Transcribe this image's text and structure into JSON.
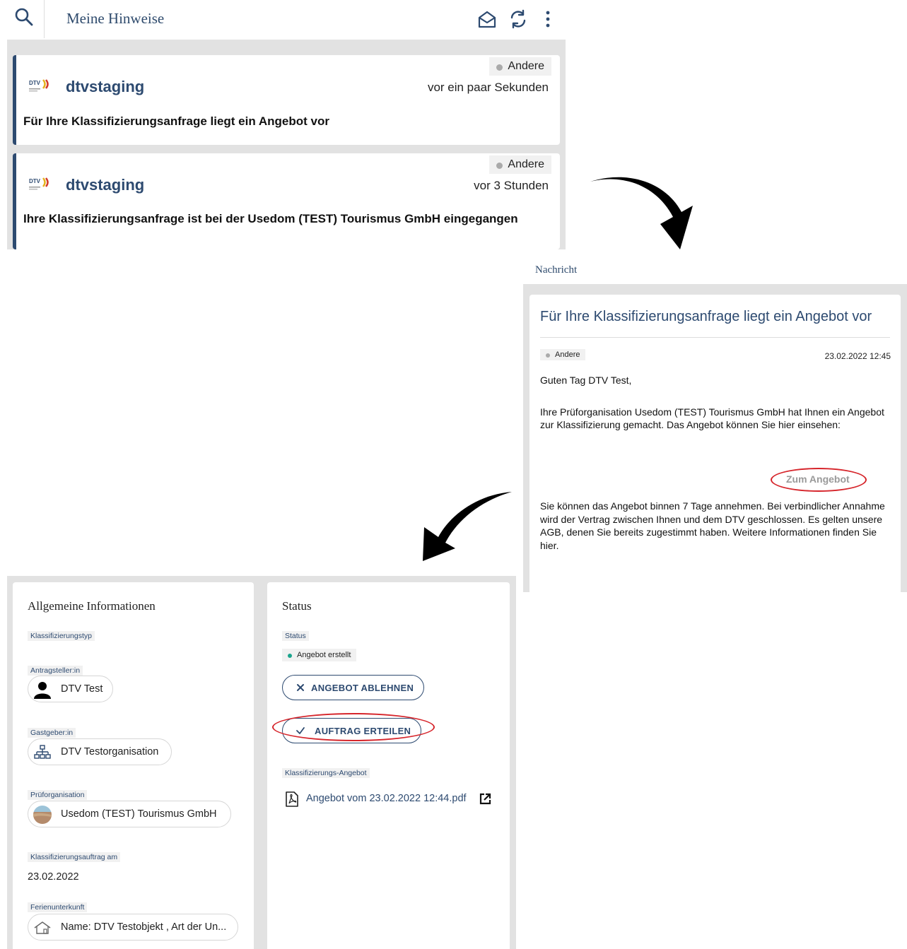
{
  "list_panel": {
    "title": "Meine Hinweise",
    "icons": [
      "search-icon",
      "envelope-open-icon",
      "refresh-icon",
      "more-vertical-icon"
    ],
    "notifications": [
      {
        "tag": "Andere",
        "sender": "dtvstaging",
        "time": "vor ein paar Sekunden",
        "text": "Für Ihre Klassifizierungsanfrage liegt ein Angebot vor"
      },
      {
        "tag": "Andere",
        "sender": "dtvstaging",
        "time": "vor 3 Stunden",
        "text": "Ihre Klassifizierungsanfrage ist bei der Usedom (TEST) Tourismus GmbH eingegangen"
      }
    ]
  },
  "message_panel": {
    "label": "Nachricht",
    "title": "Für Ihre Klassifizierungsanfrage liegt ein Angebot vor",
    "tag": "Andere",
    "date": "23.02.2022 12:45",
    "greeting": "Guten Tag DTV Test,",
    "paragraph1": "Ihre Prüforganisation Usedom (TEST) Tourismus GmbH hat Ihnen ein Angebot zur Klassifizierung gemacht. Das Angebot können Sie hier einsehen:",
    "cta_label": "Zum Angebot",
    "paragraph2": "Sie können das Angebot binnen 7 Tage annehmen. Bei verbindlicher Annahme wird der Vertrag zwischen Ihnen und dem DTV geschlossen. Es gelten unsere AGB, denen Sie bereits zugestimmt haben. Weitere Informationen finden Sie hier."
  },
  "detail_panel": {
    "info_card": {
      "title": "Allgemeine Informationen",
      "fields": {
        "type_label": "Klassifizierungstyp",
        "applicant_label": "Antragsteller:in",
        "applicant_value": "DTV Test",
        "host_label": "Gastgeber:in",
        "host_value": "DTV Testorganisation",
        "inspector_label": "Prüforganisation",
        "inspector_value": "Usedom (TEST) Tourismus GmbH",
        "order_date_label": "Klassifizierungsauftrag am",
        "order_date_value": "23.02.2022",
        "property_label": "Ferienunterkunft",
        "property_value": "Name: DTV Testobjekt , Art der Un..."
      }
    },
    "status_card": {
      "title": "Status",
      "status_label": "Status",
      "status_value": "Angebot erstellt",
      "status_color": "#1aa58d",
      "decline_button": "ANGEBOT ABLEHNEN",
      "accept_button": "AUFTRAG ERTEILEN",
      "offer_label": "Klassifizierungs-Angebot",
      "offer_file": "Angebot vom 23.02.2022 12:44.pdf"
    }
  },
  "colors": {
    "brand_blue": "#2d4a70",
    "highlight_red": "#d6252b",
    "panel_gray": "#e2e2e2"
  }
}
